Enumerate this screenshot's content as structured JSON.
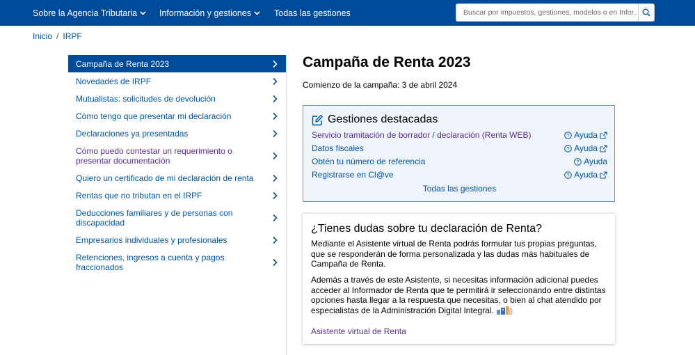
{
  "colors": {
    "brand": "#004b99",
    "link": "#0055a4",
    "visited": "#5c2d91",
    "panel_border": "#5a9ad5",
    "panel_bg": "#eef4fa"
  },
  "header": {
    "nav": [
      {
        "label": "Sobre la Agencia Tributaria",
        "icon": "chevron-down-icon"
      },
      {
        "label": "Información y gestiones",
        "icon": "chevron-down-icon"
      },
      {
        "label": "Todas las gestiones"
      }
    ],
    "search": {
      "placeholder": "Buscar por impuestos, gestiones, modelos o en Infor...",
      "icon": "search-icon"
    }
  },
  "breadcrumb": {
    "home": "Inicio",
    "separator": "/",
    "current": "IRPF"
  },
  "sidebar": {
    "items": [
      {
        "label": "Campaña de Renta 2023",
        "state": "active"
      },
      {
        "label": "Novedades de IRPF"
      },
      {
        "label": "Mutualistas: solicitudes de devolución"
      },
      {
        "label": "Cómo tengo que presentar mi declaración"
      },
      {
        "label": "Declaraciones ya presentadas"
      },
      {
        "label": "Cómo puedo contestar un requerimiento o presentar documentación",
        "state": "visited"
      },
      {
        "label": "Quiero un certificado de mi declaración de renta"
      },
      {
        "label": "Rentas que no tributan en el IRPF"
      },
      {
        "label": "Deducciones familiares y de personas con discapacidad"
      },
      {
        "label": "Empresarios individuales y profesionales"
      },
      {
        "label": "Retenciones, ingresos a cuenta y pagos fraccionados"
      }
    ]
  },
  "main": {
    "title": "Campaña de Renta 2023",
    "campaign_start": "Comienzo de la campaña: 3 de abril 2024",
    "gestiones": {
      "title": "Gestiones destacadas",
      "icon": "edit-icon",
      "items": [
        {
          "label_a": "Servicio tramitación de borrador",
          "label_sep": " / ",
          "label_b": "declaración (Renta WEB)",
          "help": "Ayuda",
          "external": true
        },
        {
          "label": "Datos fiscales",
          "help": "Ayuda",
          "external": true
        },
        {
          "label": "Obtén tu número de referencia",
          "help": "Ayuda",
          "external": false
        },
        {
          "label": "Registrarse en Cl@ve",
          "help": "Ayuda",
          "external": true
        }
      ],
      "all_link": "Todas las gestiones"
    },
    "dudas": {
      "title": "¿Tienes dudas sobre tu declaración de Renta?",
      "p1": "Mediante el Asistente virtual de Renta podrás formular tus propias preguntas, que se responderán de forma personalizada y las dudas más habituales de Campaña de Renta.",
      "p2": "Además a través de este Asistente, si necesitas información adicional puedes acceder al Informador de Renta que te permitirá ir seleccionando entre distintas opciones hasta llegar a la respuesta que necesitas, o bien al chat atendido por especialistas de la Administración Digital Integral.",
      "link": "Asistente virtual de Renta",
      "bot_icon": "assistant-bot-icon"
    }
  }
}
